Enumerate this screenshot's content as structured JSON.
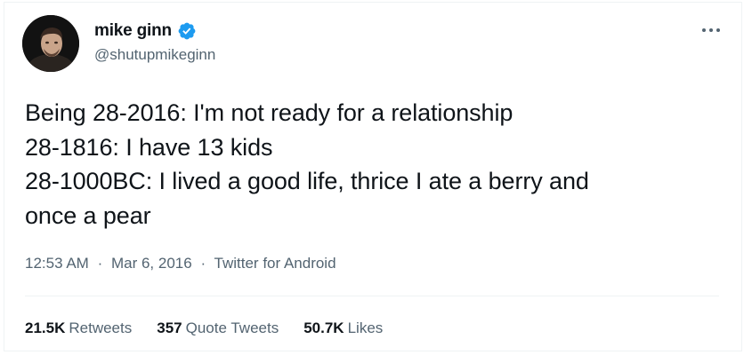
{
  "author": {
    "display_name": "mike ginn",
    "handle": "@shutupmikeginn",
    "verified": true,
    "verified_color": "#1d9bf0",
    "avatar_icon": "profile-photo"
  },
  "menu": {
    "icon": "more-dots-icon",
    "label": "···"
  },
  "tweet": {
    "lines": [
      "Being 28-2016: I'm not ready for a relationship",
      "28-1816: I have 13 kids",
      "28-1000BC: I lived a good life, thrice I ate a berry and",
      "once a pear"
    ]
  },
  "meta": {
    "time": "12:53 AM",
    "separator": "·",
    "date": "Mar 6, 2016",
    "source": "Twitter for Android"
  },
  "stats": {
    "retweets": {
      "count": "21.5K",
      "label": "Retweets"
    },
    "quote_tweets": {
      "count": "357",
      "label": "Quote Tweets"
    },
    "likes": {
      "count": "50.7K",
      "label": "Likes"
    }
  },
  "colors": {
    "text": "#0f1419",
    "secondary": "#536471",
    "divider": "#eff3f4"
  }
}
